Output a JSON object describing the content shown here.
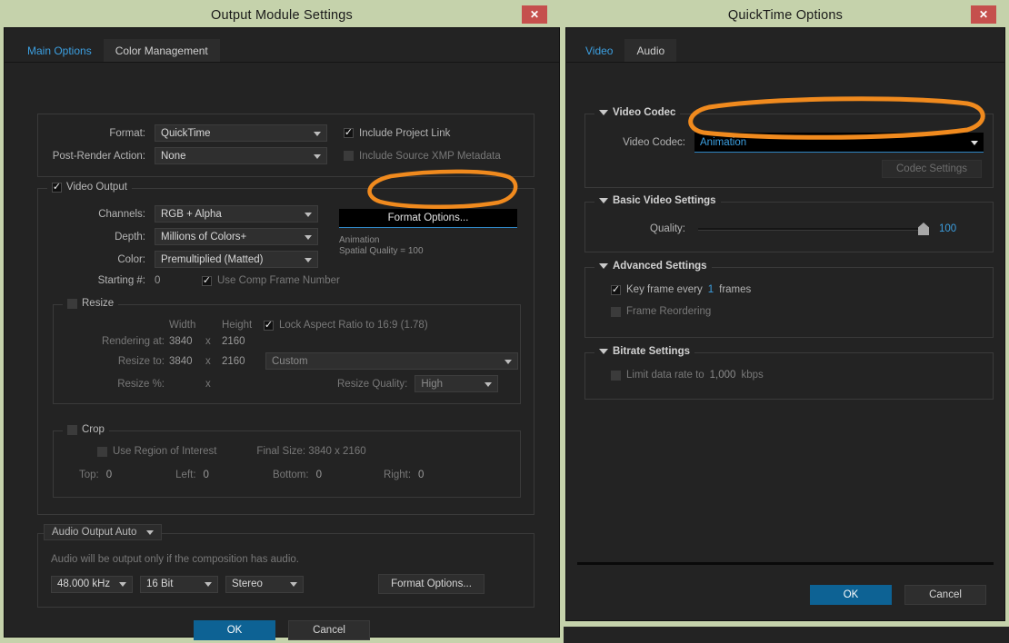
{
  "left_dialog": {
    "title": "Output Module Settings",
    "close_label": "✕",
    "tabs": [
      {
        "label": "Main Options",
        "active": true
      },
      {
        "label": "Color Management",
        "active": false
      }
    ],
    "format_group": {
      "format_label": "Format:",
      "format_value": "QuickTime",
      "post_render_label": "Post-Render Action:",
      "post_render_value": "None",
      "include_project_link": "Include Project Link",
      "include_xmp": "Include Source XMP Metadata"
    },
    "video_output": {
      "title": "Video Output",
      "channels_label": "Channels:",
      "channels_value": "RGB + Alpha",
      "depth_label": "Depth:",
      "depth_value": "Millions of Colors+",
      "color_label": "Color:",
      "color_value": "Premultiplied (Matted)",
      "format_options_button": "Format Options...",
      "format_info_line1": "Animation",
      "format_info_line2": "Spatial Quality = 100",
      "starting_label": "Starting #:",
      "starting_value": "0",
      "use_comp_frame_number": "Use Comp Frame Number"
    },
    "resize": {
      "title": "Resize",
      "width_header": "Width",
      "height_header": "Height",
      "lock_aspect": "Lock Aspect Ratio to 16:9 (1.78)",
      "rendering_label": "Rendering at:",
      "rendering_width": "3840",
      "rendering_x": "x",
      "rendering_height": "2160",
      "resize_to_label": "Resize to:",
      "resize_to_width": "3840",
      "resize_to_x": "x",
      "resize_to_height": "2160",
      "resize_preset": "Custom",
      "resize_pct_label": "Resize %:",
      "resize_pct_x": "x",
      "resize_quality_label": "Resize Quality:",
      "resize_quality_value": "High"
    },
    "crop": {
      "title": "Crop",
      "use_region": "Use Region of Interest",
      "final_size": "Final Size: 3840 x 2160",
      "top_label": "Top:",
      "top_value": "0",
      "left_label": "Left:",
      "left_value": "0",
      "bottom_label": "Bottom:",
      "bottom_value": "0",
      "right_label": "Right:",
      "right_value": "0"
    },
    "audio": {
      "title": "Audio Output Auto",
      "note": "Audio will be output only if the composition has audio.",
      "rate": "48.000 kHz",
      "depth": "16 Bit",
      "channels": "Stereo",
      "format_options_button": "Format Options..."
    },
    "footer": {
      "ok": "OK",
      "cancel": "Cancel"
    }
  },
  "right_dialog": {
    "title": "QuickTime Options",
    "close_label": "✕",
    "tabs": [
      {
        "label": "Video",
        "active": true
      },
      {
        "label": "Audio",
        "active": false
      }
    ],
    "video_codec": {
      "title": "Video Codec",
      "label": "Video Codec:",
      "value": "Animation",
      "codec_settings_button": "Codec Settings"
    },
    "basic_video": {
      "title": "Basic Video Settings",
      "quality_label": "Quality:",
      "quality_value": "100"
    },
    "advanced": {
      "title": "Advanced Settings",
      "key_frame_label": "Key frame every",
      "key_frame_value": "1",
      "key_frame_unit": "frames",
      "frame_reordering": "Frame Reordering"
    },
    "bitrate": {
      "title": "Bitrate Settings",
      "limit_label": "Limit data rate to",
      "limit_value": "1,000",
      "limit_unit": "kbps"
    },
    "footer": {
      "ok": "OK",
      "cancel": "Cancel"
    }
  },
  "annotations": {
    "highlight_color": "#f08a1e",
    "items": [
      {
        "name": "format-options-highlight"
      },
      {
        "name": "video-codec-highlight"
      }
    ]
  }
}
